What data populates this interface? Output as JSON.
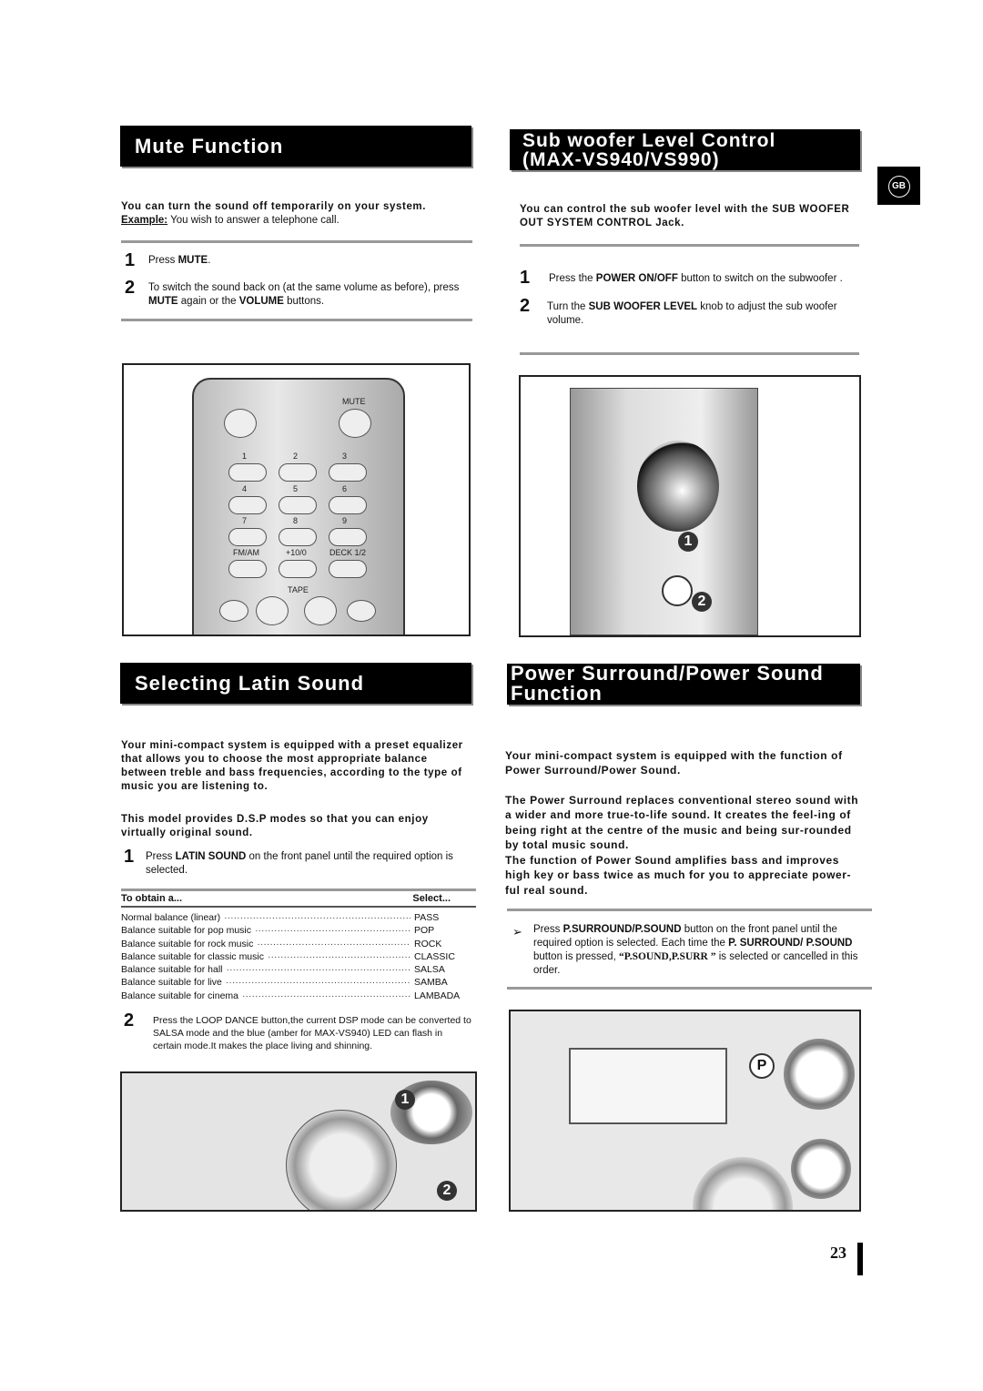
{
  "side_tab": "GB",
  "page_number": "23",
  "mute": {
    "title": "Mute Function",
    "intro": "You can turn the sound off temporarily on your system.",
    "example_label": "Example:",
    "example_text": " You wish to answer a telephone call.",
    "steps": [
      {
        "num": "1",
        "parts": [
          "Press ",
          "MUTE",
          "."
        ]
      },
      {
        "num": "2",
        "parts": [
          "To switch the sound back on (at the same volume as before), press ",
          "MUTE",
          " again or the ",
          "VOLUME",
          " buttons."
        ]
      }
    ],
    "remote_labels": {
      "mute": "MUTE",
      "keys": [
        "1",
        "2",
        "3",
        "4",
        "5",
        "6",
        "7",
        "8",
        "9"
      ],
      "fm": "FM/AM",
      "plus10": "+10/0",
      "deck": "DECK 1/2",
      "tape": "TAPE"
    }
  },
  "subwoofer": {
    "title_line1": "Sub woofer Level Control",
    "title_line2": "(MAX-VS940/VS990)",
    "intro": "You can control the sub woofer level with the SUB WOOFER OUT SYSTEM CONTROL Jack.",
    "steps": [
      {
        "num": "1",
        "parts": [
          "Press the ",
          "POWER ON/OFF",
          " button to switch on the subwoofer ."
        ]
      },
      {
        "num": "2",
        "parts": [
          "Turn the ",
          "SUB WOOFER LEVEL",
          " knob to adjust the sub woofer volume."
        ]
      }
    ],
    "callouts": [
      "1",
      "2"
    ]
  },
  "latin": {
    "title": "Selecting Latin Sound",
    "intro1": "Your mini-compact system is equipped with a preset equalizer that allows you to choose the most appropriate balance between treble and bass frequencies, according to the type of music you are listening to.",
    "intro2": "This model provides D.S.P modes so that you can enjoy virtually original sound.",
    "step1": {
      "num": "1",
      "parts": [
        "Press ",
        "LATIN SOUND",
        " on the front panel until the required option is selected."
      ]
    },
    "table": {
      "headers": [
        "To obtain a...",
        "Select..."
      ],
      "rows": [
        [
          "Normal balance (linear)",
          "PASS"
        ],
        [
          "Balance suitable for pop music",
          "POP"
        ],
        [
          "Balance suitable for rock music",
          "ROCK"
        ],
        [
          "Balance suitable for classic music",
          "CLASSIC"
        ],
        [
          "Balance suitable for hall",
          "SALSA"
        ],
        [
          "Balance suitable for live",
          "SAMBA"
        ],
        [
          "Balance suitable for cinema",
          "LAMBADA"
        ]
      ]
    },
    "step2": {
      "num": "2",
      "text": "Press the LOOP DANCE button,the current DSP mode can be converted to  SALSA mode and the blue (amber for MAX-VS940) LED can flash in certain mode.It makes the place living and shinning."
    },
    "callouts": [
      "1",
      "2"
    ]
  },
  "surround": {
    "title_line1": "Power Surround/Power Sound",
    "title_line2": "Function",
    "intro": "Your mini-compact system is equipped with the function of Power Surround/Power Sound.",
    "para1": "The Power Surround replaces conventional stereo sound with a wider and more true-to-life sound. It creates the feel-ing of being right at the centre of the music and being sur-rounded by total music sound.",
    "para2": "The function of Power Sound amplifies bass and improves high key or bass twice as much for you to appreciate power-ful real sound.",
    "step": {
      "parts": [
        "Press ",
        "P.SURROUND/P.SOUND",
        " button on the front panel until the required option is selected. Each time the ",
        "P. SURROUND/ P.SOUND",
        " button is pressed, ",
        "“P.SOUND,P.SURR ”",
        " is selected or cancelled in this order."
      ]
    }
  }
}
